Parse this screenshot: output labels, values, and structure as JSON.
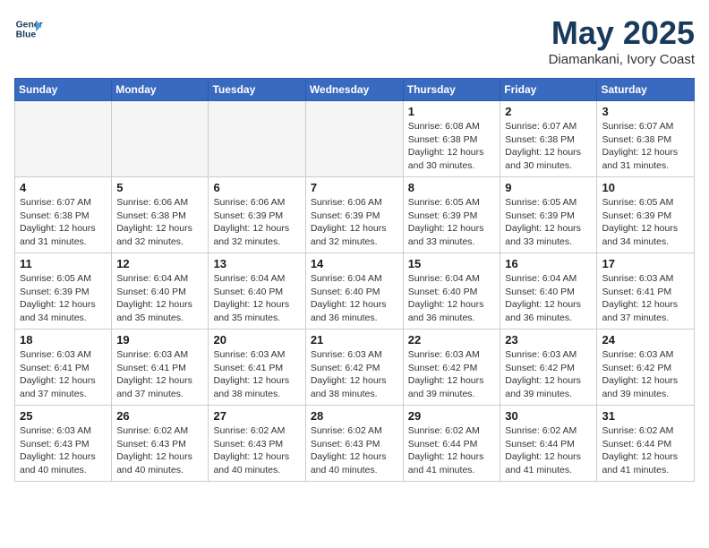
{
  "header": {
    "logo_line1": "General",
    "logo_line2": "Blue",
    "month": "May 2025",
    "location": "Diamankani, Ivory Coast"
  },
  "days_of_week": [
    "Sunday",
    "Monday",
    "Tuesday",
    "Wednesday",
    "Thursday",
    "Friday",
    "Saturday"
  ],
  "weeks": [
    [
      {
        "day": "",
        "info": ""
      },
      {
        "day": "",
        "info": ""
      },
      {
        "day": "",
        "info": ""
      },
      {
        "day": "",
        "info": ""
      },
      {
        "day": "1",
        "info": "Sunrise: 6:08 AM\nSunset: 6:38 PM\nDaylight: 12 hours\nand 30 minutes."
      },
      {
        "day": "2",
        "info": "Sunrise: 6:07 AM\nSunset: 6:38 PM\nDaylight: 12 hours\nand 30 minutes."
      },
      {
        "day": "3",
        "info": "Sunrise: 6:07 AM\nSunset: 6:38 PM\nDaylight: 12 hours\nand 31 minutes."
      }
    ],
    [
      {
        "day": "4",
        "info": "Sunrise: 6:07 AM\nSunset: 6:38 PM\nDaylight: 12 hours\nand 31 minutes."
      },
      {
        "day": "5",
        "info": "Sunrise: 6:06 AM\nSunset: 6:38 PM\nDaylight: 12 hours\nand 32 minutes."
      },
      {
        "day": "6",
        "info": "Sunrise: 6:06 AM\nSunset: 6:39 PM\nDaylight: 12 hours\nand 32 minutes."
      },
      {
        "day": "7",
        "info": "Sunrise: 6:06 AM\nSunset: 6:39 PM\nDaylight: 12 hours\nand 32 minutes."
      },
      {
        "day": "8",
        "info": "Sunrise: 6:05 AM\nSunset: 6:39 PM\nDaylight: 12 hours\nand 33 minutes."
      },
      {
        "day": "9",
        "info": "Sunrise: 6:05 AM\nSunset: 6:39 PM\nDaylight: 12 hours\nand 33 minutes."
      },
      {
        "day": "10",
        "info": "Sunrise: 6:05 AM\nSunset: 6:39 PM\nDaylight: 12 hours\nand 34 minutes."
      }
    ],
    [
      {
        "day": "11",
        "info": "Sunrise: 6:05 AM\nSunset: 6:39 PM\nDaylight: 12 hours\nand 34 minutes."
      },
      {
        "day": "12",
        "info": "Sunrise: 6:04 AM\nSunset: 6:40 PM\nDaylight: 12 hours\nand 35 minutes."
      },
      {
        "day": "13",
        "info": "Sunrise: 6:04 AM\nSunset: 6:40 PM\nDaylight: 12 hours\nand 35 minutes."
      },
      {
        "day": "14",
        "info": "Sunrise: 6:04 AM\nSunset: 6:40 PM\nDaylight: 12 hours\nand 36 minutes."
      },
      {
        "day": "15",
        "info": "Sunrise: 6:04 AM\nSunset: 6:40 PM\nDaylight: 12 hours\nand 36 minutes."
      },
      {
        "day": "16",
        "info": "Sunrise: 6:04 AM\nSunset: 6:40 PM\nDaylight: 12 hours\nand 36 minutes."
      },
      {
        "day": "17",
        "info": "Sunrise: 6:03 AM\nSunset: 6:41 PM\nDaylight: 12 hours\nand 37 minutes."
      }
    ],
    [
      {
        "day": "18",
        "info": "Sunrise: 6:03 AM\nSunset: 6:41 PM\nDaylight: 12 hours\nand 37 minutes."
      },
      {
        "day": "19",
        "info": "Sunrise: 6:03 AM\nSunset: 6:41 PM\nDaylight: 12 hours\nand 37 minutes."
      },
      {
        "day": "20",
        "info": "Sunrise: 6:03 AM\nSunset: 6:41 PM\nDaylight: 12 hours\nand 38 minutes."
      },
      {
        "day": "21",
        "info": "Sunrise: 6:03 AM\nSunset: 6:42 PM\nDaylight: 12 hours\nand 38 minutes."
      },
      {
        "day": "22",
        "info": "Sunrise: 6:03 AM\nSunset: 6:42 PM\nDaylight: 12 hours\nand 39 minutes."
      },
      {
        "day": "23",
        "info": "Sunrise: 6:03 AM\nSunset: 6:42 PM\nDaylight: 12 hours\nand 39 minutes."
      },
      {
        "day": "24",
        "info": "Sunrise: 6:03 AM\nSunset: 6:42 PM\nDaylight: 12 hours\nand 39 minutes."
      }
    ],
    [
      {
        "day": "25",
        "info": "Sunrise: 6:03 AM\nSunset: 6:43 PM\nDaylight: 12 hours\nand 40 minutes."
      },
      {
        "day": "26",
        "info": "Sunrise: 6:02 AM\nSunset: 6:43 PM\nDaylight: 12 hours\nand 40 minutes."
      },
      {
        "day": "27",
        "info": "Sunrise: 6:02 AM\nSunset: 6:43 PM\nDaylight: 12 hours\nand 40 minutes."
      },
      {
        "day": "28",
        "info": "Sunrise: 6:02 AM\nSunset: 6:43 PM\nDaylight: 12 hours\nand 40 minutes."
      },
      {
        "day": "29",
        "info": "Sunrise: 6:02 AM\nSunset: 6:44 PM\nDaylight: 12 hours\nand 41 minutes."
      },
      {
        "day": "30",
        "info": "Sunrise: 6:02 AM\nSunset: 6:44 PM\nDaylight: 12 hours\nand 41 minutes."
      },
      {
        "day": "31",
        "info": "Sunrise: 6:02 AM\nSunset: 6:44 PM\nDaylight: 12 hours\nand 41 minutes."
      }
    ]
  ]
}
